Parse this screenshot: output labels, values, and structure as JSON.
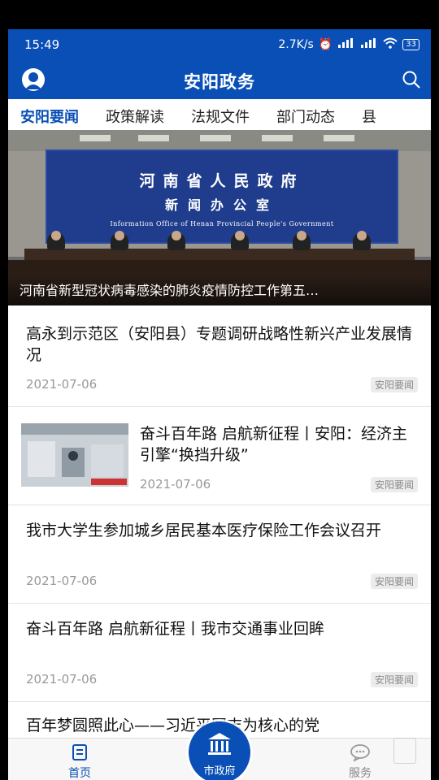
{
  "status_bar": {
    "time": "15:49",
    "speed": "2.7K/s",
    "battery": "33"
  },
  "header": {
    "title": "安阳政务"
  },
  "tabs": [
    {
      "label": "安阳要闻",
      "active": true
    },
    {
      "label": "政策解读",
      "active": false
    },
    {
      "label": "法规文件",
      "active": false
    },
    {
      "label": "部门动态",
      "active": false
    },
    {
      "label": "县",
      "active": false
    }
  ],
  "banner": {
    "backdrop_line1": "河南省人民政府",
    "backdrop_line2": "新闻办公室",
    "backdrop_english": "Information Office of Henan Provincial People's Government",
    "caption": "河南省新型冠状病毒感染的肺炎疫情防控工作第五…"
  },
  "news": [
    {
      "title": "高永到示范区（安阳县）专题调研战略性新兴产业发展情况",
      "date": "2021-07-06",
      "tag": "安阳要闻",
      "has_thumb": false
    },
    {
      "title": "奋斗百年路 启航新征程丨安阳：经济主引擎“换挡升级”",
      "date": "2021-07-06",
      "tag": "安阳要闻",
      "has_thumb": true
    },
    {
      "title": "我市大学生参加城乡居民基本医疗保险工作会议召开",
      "date": "2021-07-06",
      "tag": "安阳要闻",
      "has_thumb": false
    },
    {
      "title": "奋斗百年路 启航新征程丨我市交通事业回眸",
      "date": "2021-07-06",
      "tag": "安阳要闻",
      "has_thumb": false
    },
    {
      "title": "百年梦圆照此心——习近平同志为核心的党",
      "date": "",
      "tag": "",
      "has_thumb": false
    }
  ],
  "bottom_nav": {
    "home_label": "首页",
    "center_label": "市政府",
    "service_label": "服务"
  },
  "colors": {
    "brand_blue": "#0a4fb6"
  }
}
